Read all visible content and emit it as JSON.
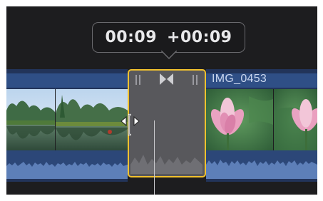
{
  "tooltip": {
    "duration": "00:09",
    "delta": "+00:09"
  },
  "timeline": {
    "right_clip_name": "IMG_0453"
  },
  "colors": {
    "selection_border": "#f2c22e",
    "clip_title_bar": "#2f4f86",
    "audio_waveform": "#5d7fb8",
    "transition_fill": "#58585c"
  },
  "icons": {
    "transition": "cross-dissolve-icon",
    "trim": "ripple-trim-cursor-icon"
  }
}
